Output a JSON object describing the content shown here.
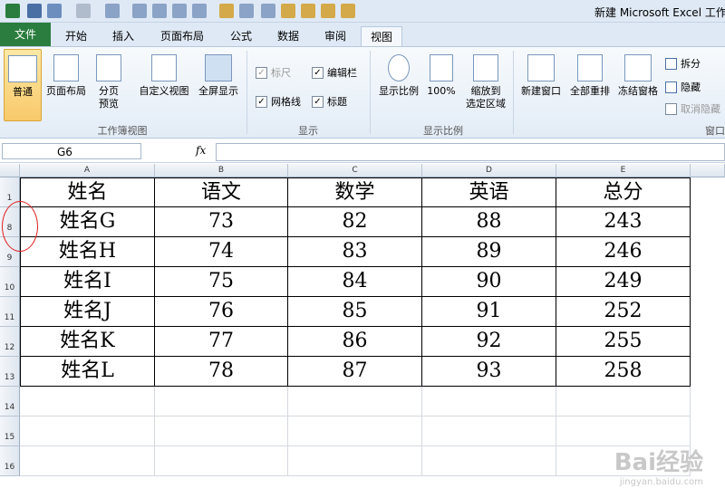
{
  "window": {
    "title": "新建 Microsoft Excel 工作"
  },
  "tabs": [
    "文件",
    "开始",
    "插入",
    "页面布局",
    "公式",
    "数据",
    "审阅",
    "视图"
  ],
  "active_tab": "视图",
  "ribbon": {
    "workbook_views": {
      "label": "工作簿视图",
      "normal": "普通",
      "page_layout": "页面布局",
      "page_break_1": "分页",
      "page_break_2": "预览",
      "custom_view": "自定义视图",
      "full_screen": "全屏显示"
    },
    "show": {
      "label": "显示",
      "ruler": "标尺",
      "formula_bar": "编辑栏",
      "gridlines": "网格线",
      "headings": "标题"
    },
    "zoom": {
      "label": "显示比例",
      "zoom": "显示比例",
      "hundred": "100%",
      "zoom_sel_1": "缩放到",
      "zoom_sel_2": "选定区域"
    },
    "window": {
      "label": "窗口",
      "new_window": "新建窗口",
      "arrange_all": "全部重排",
      "freeze": "冻结窗格",
      "split": "拆分",
      "hide": "隐藏",
      "unhide": "取消隐藏"
    }
  },
  "formula_bar": {
    "name_box": "G6",
    "fx": "fx",
    "value": ""
  },
  "columns": [
    "A",
    "B",
    "C",
    "D",
    "E"
  ],
  "rows": [
    {
      "num": "1",
      "cells": [
        "姓名",
        "语文",
        "数学",
        "英语",
        "总分"
      ]
    },
    {
      "num": "8",
      "cells": [
        "姓名G",
        "73",
        "82",
        "88",
        "243"
      ]
    },
    {
      "num": "9",
      "cells": [
        "姓名H",
        "74",
        "83",
        "89",
        "246"
      ]
    },
    {
      "num": "10",
      "cells": [
        "姓名I",
        "75",
        "84",
        "90",
        "249"
      ]
    },
    {
      "num": "11",
      "cells": [
        "姓名J",
        "76",
        "85",
        "91",
        "252"
      ]
    },
    {
      "num": "12",
      "cells": [
        "姓名K",
        "77",
        "86",
        "92",
        "255"
      ]
    },
    {
      "num": "13",
      "cells": [
        "姓名L",
        "78",
        "87",
        "93",
        "258"
      ]
    },
    {
      "num": "14",
      "cells": [
        "",
        "",
        "",
        "",
        ""
      ]
    },
    {
      "num": "15",
      "cells": [
        "",
        "",
        "",
        "",
        ""
      ]
    },
    {
      "num": "16",
      "cells": [
        "",
        "",
        "",
        "",
        ""
      ]
    }
  ],
  "watermark": {
    "brand": "Bai经验",
    "url": "jingyan.baidu.com"
  }
}
